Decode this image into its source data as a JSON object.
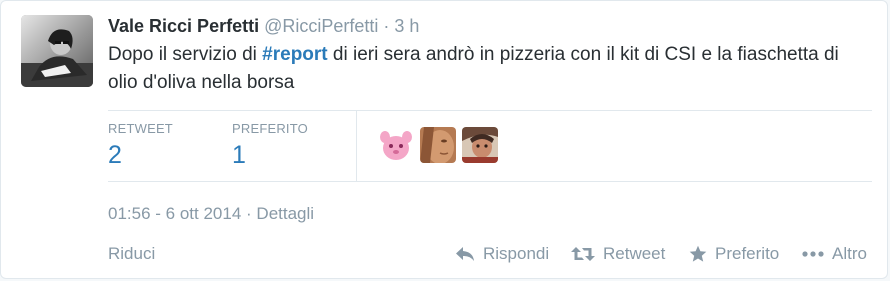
{
  "tweet": {
    "author": {
      "fullname": "Vale Ricci Perfetti",
      "username": "@RicciPerfetti",
      "separator": "·",
      "time": "3 h"
    },
    "text": {
      "before": "Dopo il servizio di ",
      "hashtag": "#report",
      "after": " di ieri sera andrò in pizzeria con il kit di CSI e la fiaschetta di olio d'oliva nella borsa"
    },
    "stats": {
      "retweet_label": "RETWEET",
      "retweet_count": "2",
      "favorite_label": "PREFERITO",
      "favorite_count": "1"
    },
    "likers": [
      {
        "icon": "pink-creature-avatar"
      },
      {
        "icon": "face-closeup-avatar"
      },
      {
        "icon": "person-photo-avatar"
      }
    ],
    "meta": {
      "timestamp": "01:56 - 6 ott 2014",
      "separator": "·",
      "details_label": "Dettagli"
    },
    "footer": {
      "collapse_label": "Riduci",
      "reply_label": "Rispondi",
      "retweet_label": "Retweet",
      "favorite_label": "Preferito",
      "more_label": "Altro"
    }
  },
  "colors": {
    "link": "#2b7bb9",
    "muted": "#8899a6",
    "text": "#292f33",
    "border": "#e1e8ed"
  }
}
